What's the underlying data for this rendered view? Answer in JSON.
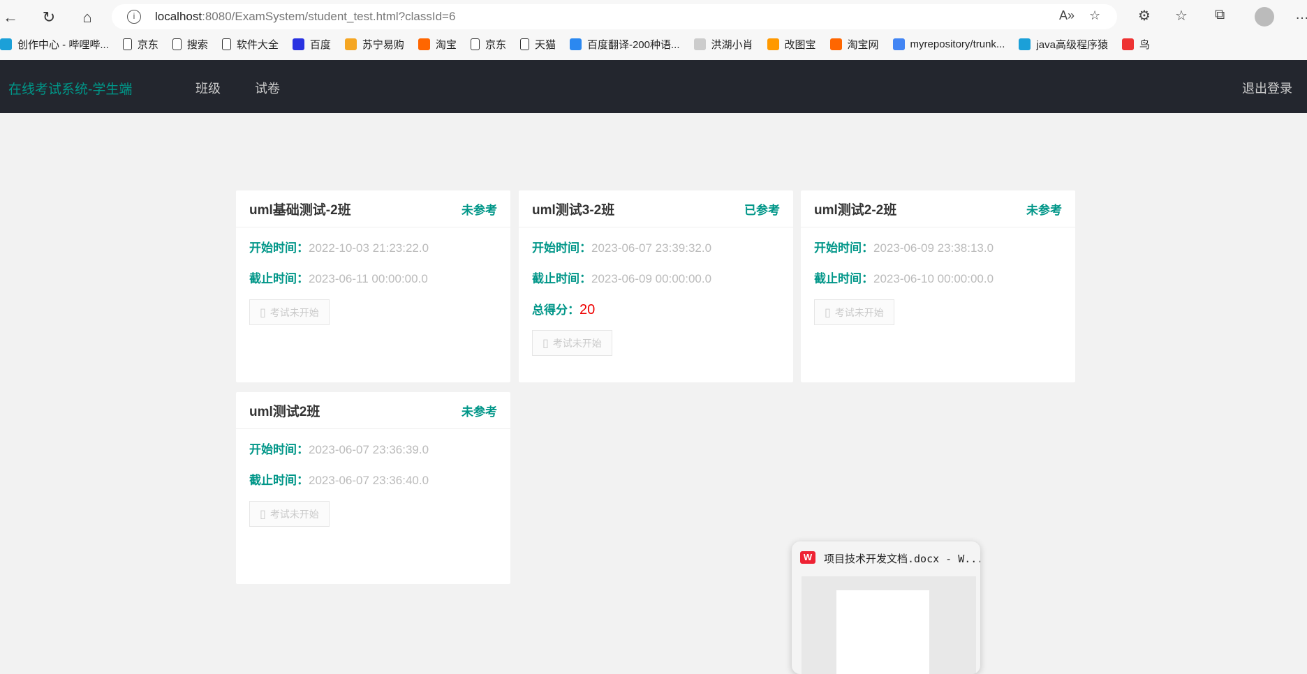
{
  "browser": {
    "url_host": "localhost",
    "url_rest": ":8080/ExamSystem/student_test.html?classId=6",
    "bookmarks": [
      "创作中心 - 哔哩哔...",
      "京东",
      "搜索",
      "软件大全",
      "百度",
      "苏宁易购",
      "淘宝",
      "京东",
      "天猫",
      "百度翻译-200种语...",
      "洪湖小肖",
      "改图宝",
      "淘宝网",
      "myrepository/trunk...",
      "java高级程序猿",
      "鸟"
    ]
  },
  "nav": {
    "brand": "在线考试系统-学生端",
    "items": [
      "班级",
      "试卷"
    ],
    "logout": "退出登录"
  },
  "labels": {
    "start": "开始时间：",
    "end": "截止时间：",
    "score": "总得分：",
    "button": "考试未开始"
  },
  "exams": [
    {
      "title": "uml基础测试-2班",
      "status": "未参考",
      "start": "2022-10-03 21:23:22.0",
      "end": "2023-06-11 00:00:00.0"
    },
    {
      "title": "uml测试3-2班",
      "status": "已参考",
      "start": "2023-06-07 23:39:32.0",
      "end": "2023-06-09 00:00:00.0",
      "score": "20"
    },
    {
      "title": "uml测试2-2班",
      "status": "未参考",
      "start": "2023-06-09 23:38:13.0",
      "end": "2023-06-10 00:00:00.0"
    },
    {
      "title": "uml测试2班",
      "status": "未参考",
      "start": "2023-06-07 23:36:39.0",
      "end": "2023-06-07 23:36:40.0"
    }
  ],
  "taskbar_preview": {
    "title": "项目技术开发文档.docx - W..."
  }
}
